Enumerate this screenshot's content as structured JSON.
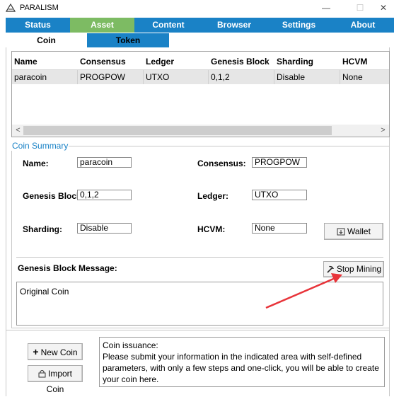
{
  "window": {
    "title": "PARALISM",
    "minimize": "—",
    "maximize": "☐",
    "close": "✕"
  },
  "main_tabs": [
    "Status",
    "Asset",
    "Content",
    "Browser",
    "Settings",
    "About"
  ],
  "sub_tabs": [
    "Coin",
    "Token"
  ],
  "grid": {
    "headers": [
      "Name",
      "Consensus",
      "Ledger",
      "Genesis Block",
      "Sharding",
      "HCVM"
    ],
    "rows": [
      [
        "paracoin",
        "PROGPOW",
        "UTXO",
        "0,1,2",
        "Disable",
        "None"
      ]
    ],
    "scroll_left": "<",
    "scroll_right": ">"
  },
  "summary": {
    "title": "Coin Summary",
    "name_label": "Name:",
    "name_value": "paracoin",
    "consensus_label": "Consensus:",
    "consensus_value": "PROGPOW",
    "genesis_label": "Genesis Block:",
    "genesis_value": "0,1,2",
    "ledger_label": "Ledger:",
    "ledger_value": "UTXO",
    "sharding_label": "Sharding:",
    "sharding_value": "Disable",
    "hcvm_label": "HCVM:",
    "hcvm_value": "None",
    "wallet_button": "Wallet",
    "genesis_message_label": "Genesis Block Message:",
    "stop_mining_button": "Stop Mining",
    "genesis_message": "Original Coin"
  },
  "actions": {
    "new_coin": "New Coin",
    "import_coin": "Import Coin"
  },
  "info": {
    "title": "Coin issuance:",
    "body": "Please submit your information in the indicated area with self-defined parameters, with only a few steps and one-click, you will be able to create your coin here."
  },
  "colors": {
    "tab_blue": "#1a82c6",
    "tab_active_green": "#7dbb63",
    "annotation_arrow": "#e8343a"
  },
  "icons": {
    "logo": "triangle-logo-icon",
    "wallet": "wallet-icon",
    "mining": "pickaxe-icon",
    "new": "plus-icon",
    "import": "import-icon"
  }
}
